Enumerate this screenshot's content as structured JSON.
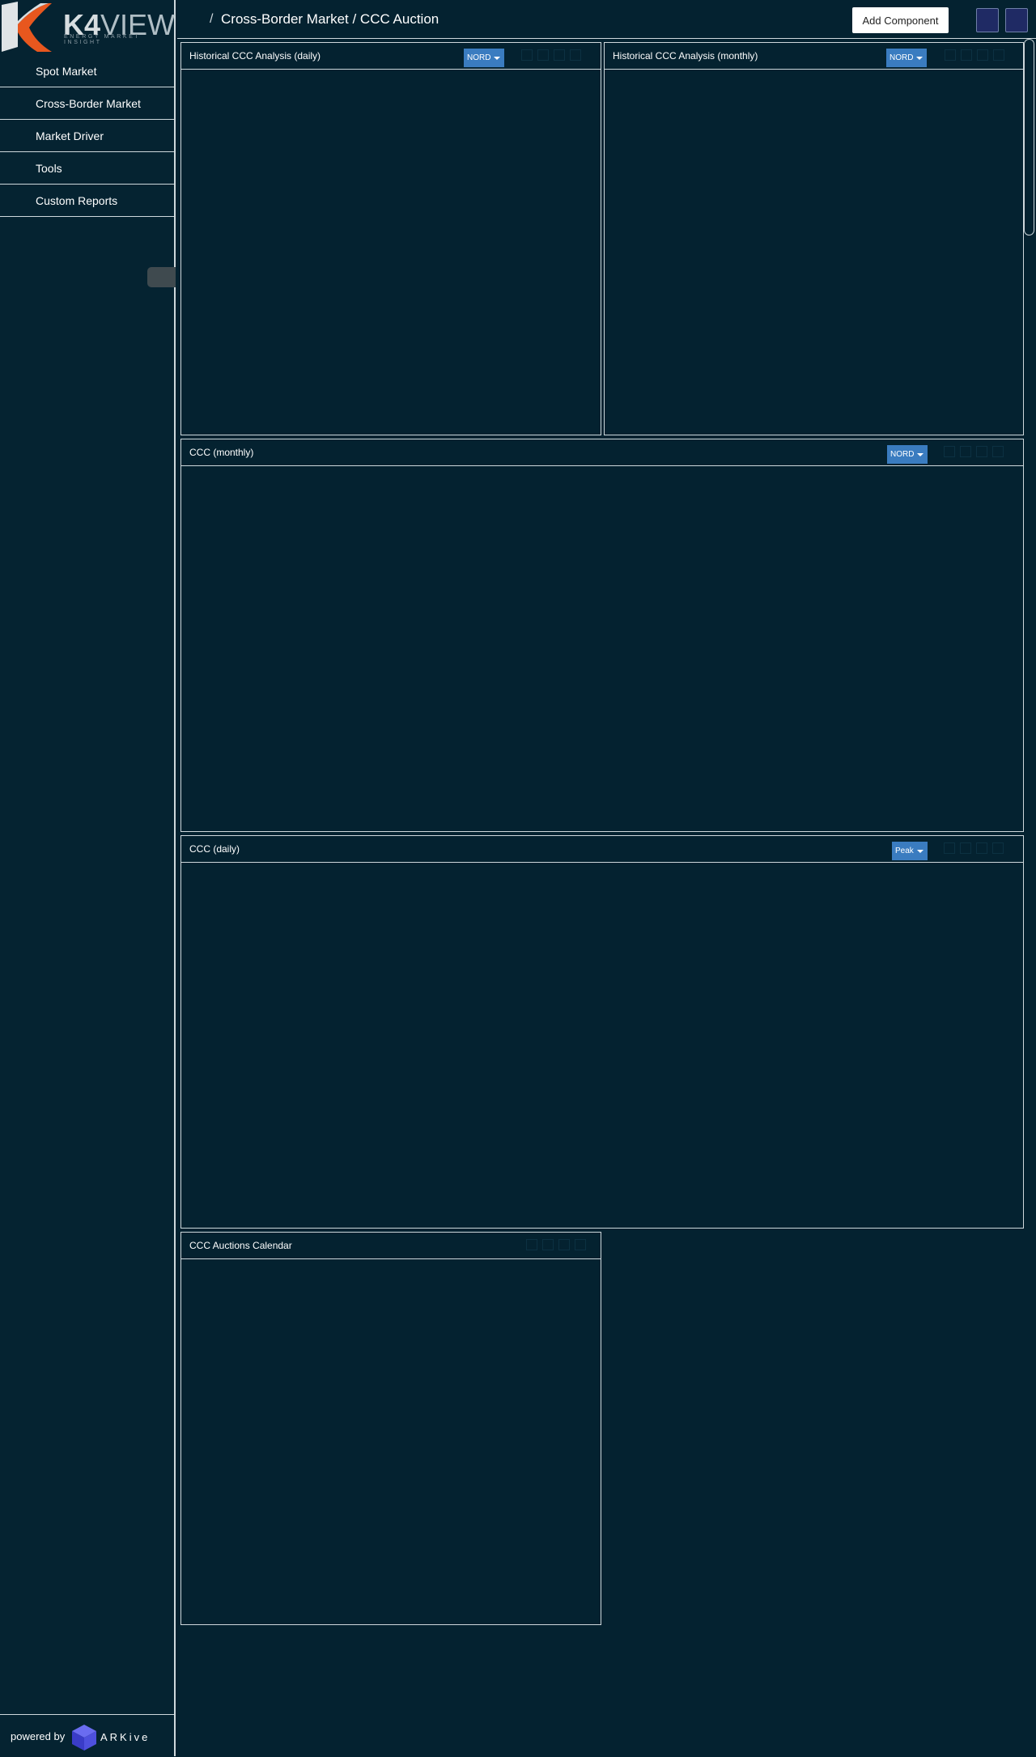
{
  "brand": {
    "logo_prefix": "K4",
    "logo_main": "VIEW",
    "tagline": "ENERGY MARKET INSIGHT",
    "accent_color": "#e8571e"
  },
  "sidebar": {
    "items": [
      {
        "label": "Spot Market"
      },
      {
        "label": "Cross-Border Market"
      },
      {
        "label": "Market Driver"
      },
      {
        "label": "Tools"
      },
      {
        "label": "Custom Reports"
      }
    ],
    "footer": {
      "powered_by": "powered by",
      "partner": "ARKive"
    }
  },
  "header": {
    "separator": "/",
    "breadcrumb": "Cross-Border Market / CCC Auction",
    "add_component": "Add Component"
  },
  "panels": [
    {
      "title": "Historical CCC Analysis (daily)",
      "selector": "NORD"
    },
    {
      "title": "Historical CCC Analysis (monthly)",
      "selector": "NORD"
    },
    {
      "title": "CCC (monthly)",
      "selector": "NORD"
    },
    {
      "title": "CCC (daily)",
      "selector": "Peak"
    },
    {
      "title": "CCC Auctions Calendar"
    }
  ]
}
